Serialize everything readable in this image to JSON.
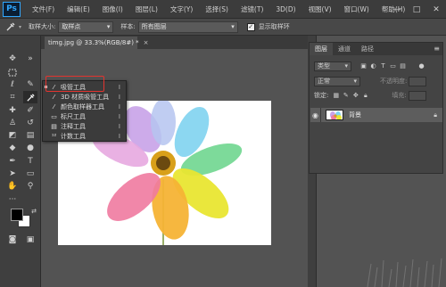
{
  "app": {
    "logo": "Ps"
  },
  "menu": [
    "文件(F)",
    "编辑(E)",
    "图像(I)",
    "图层(L)",
    "文字(Y)",
    "选择(S)",
    "滤镜(T)",
    "3D(D)",
    "视图(V)",
    "窗口(W)",
    "帮助(H)"
  ],
  "window_controls": {
    "minimize": "—",
    "maximize": "□",
    "close": "✕"
  },
  "options": {
    "sample_size_label": "取样大小:",
    "sample_size_value": "取样点",
    "sample_label": "样本:",
    "sample_value": "所有图层",
    "show_ring_label": "显示取样环",
    "show_ring_checked": true
  },
  "document": {
    "tab_title": "timg.jpg @ 33.3%(RGB/8#) *",
    "close": "×"
  },
  "flyout": {
    "items": [
      {
        "icon": "eyedropper-icon",
        "label": "吸管工具",
        "shortcut": "I"
      },
      {
        "icon": "3d-eyedropper-icon",
        "label": "3D 材质吸管工具",
        "shortcut": "I"
      },
      {
        "icon": "color-sampler-icon",
        "label": "颜色取样器工具",
        "shortcut": "I"
      },
      {
        "icon": "ruler-icon",
        "label": "标尺工具",
        "shortcut": "I"
      },
      {
        "icon": "note-icon",
        "label": "注释工具",
        "shortcut": "I"
      },
      {
        "icon": "count-icon",
        "label": "计数工具",
        "shortcut": "I"
      }
    ]
  },
  "layers_panel": {
    "tabs": [
      "图层",
      "通道",
      "路径"
    ],
    "active_tab": "图层",
    "filter_label": "类型",
    "blend_mode": "正常",
    "opacity_label": "不透明度:",
    "lock_label": "锁定:",
    "fill_label": "填充:",
    "layers": [
      {
        "name": "背景",
        "visible": true,
        "locked": true
      }
    ]
  },
  "colors": {
    "accent_red": "#e3342f",
    "ps_blue": "#31a8ff",
    "foreground": "#000000",
    "background": "#ffffff"
  }
}
